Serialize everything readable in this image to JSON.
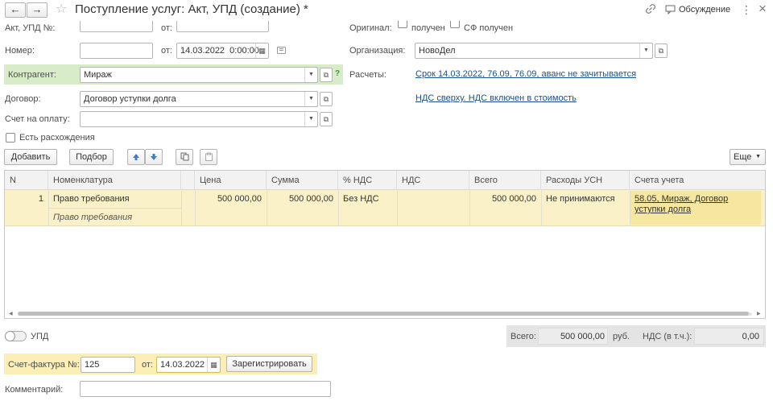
{
  "window": {
    "title": "Поступление услуг: Акт, УПД (создание) *",
    "discussion_label": "Обсуждение",
    "more_glyph": "⋮",
    "close_glyph": "×"
  },
  "header": {
    "act_label": "Акт, УПД №:",
    "ot_label": "от:",
    "original_label": "Оригинал:",
    "original_received": "получен",
    "sf_received": "СФ получен",
    "number_label": "Номер:",
    "number_value": "",
    "date_value": "14.03.2022  0:00:00",
    "organization_label": "Организация:",
    "organization_value": "НовоДел",
    "kontragent_label": "Контрагент:",
    "kontragent_value": "Мираж",
    "kontragent_help": "?",
    "raschety_label": "Расчеты:",
    "raschety_link": "Срок 14.03.2022, 76.09, 76.09, аванс не зачитывается",
    "nds_link": "НДС сверху. НДС включен в стоимость",
    "dogovor_label": "Договор:",
    "dogovor_value": "Договор уступки долга",
    "schet_label": "Счет на оплату:",
    "schet_value": "",
    "discrepancy_label": "Есть расхождения"
  },
  "toolbar": {
    "add_label": "Добавить",
    "select_label": "Подбор",
    "more_label": "Еще"
  },
  "table": {
    "columns": [
      "N",
      "Номенклатура",
      "Цена",
      "Сумма",
      "% НДС",
      "НДС",
      "Всего",
      "Расходы УСН",
      "Счета учета"
    ],
    "rows": [
      {
        "n": "1",
        "nomenclature": "Право требования",
        "nomenclature_sub": "Право требования",
        "price": "500 000,00",
        "sum": "500 000,00",
        "vat_rate": "Без НДС",
        "vat": "",
        "total": "500 000,00",
        "usn": "Не принимаются",
        "accounts": "58.05, Мираж, Договор уступки долга"
      }
    ]
  },
  "footer": {
    "upd_label": "УПД",
    "total_label": "Всего:",
    "total_value": "500 000,00",
    "currency": "руб.",
    "vat_label": "НДС (в т.ч.):",
    "vat_value": "0,00",
    "invoice_label": "Счет-фактура №:",
    "invoice_number": "125",
    "invoice_ot": "от:",
    "invoice_date": "14.03.2022",
    "register_label": "Зарегистрировать",
    "comment_label": "Комментарий:",
    "comment_value": ""
  },
  "colors": {
    "highlight_green": "#d9ecc9",
    "highlight_yellow": "#fbeeb6",
    "row_selected": "#fbf1c9",
    "link": "#1a4f8b",
    "arrow_blue": "#3f7cc7"
  }
}
